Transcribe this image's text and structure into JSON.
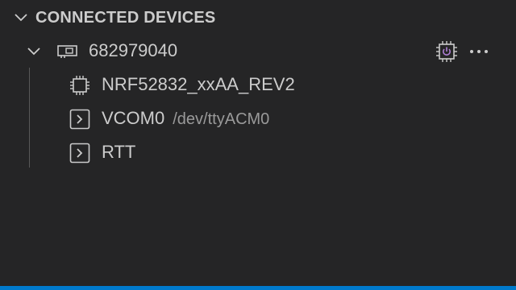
{
  "section": {
    "title": "CONNECTED DEVICES",
    "expanded_icon": "chevron-down-icon"
  },
  "device": {
    "label": "682979040",
    "icon": "device-board-icon",
    "expanded_icon": "chevron-down-icon",
    "actions": [
      {
        "name": "power-chip-icon",
        "accent": "#b180d7"
      },
      {
        "name": "more-actions-icon"
      }
    ],
    "children": [
      {
        "label": "NRF52832_xxAA_REV2",
        "description": "",
        "icon": "chip-icon"
      },
      {
        "label": "VCOM0",
        "description": "/dev/ttyACM0",
        "icon": "terminal-icon"
      },
      {
        "label": "RTT",
        "description": "",
        "icon": "terminal-icon"
      }
    ]
  },
  "colors": {
    "background": "#252526",
    "text": "#cccccc",
    "description": "#9a9a9a",
    "status_bar": "#007acc",
    "accent": "#b180d7"
  }
}
